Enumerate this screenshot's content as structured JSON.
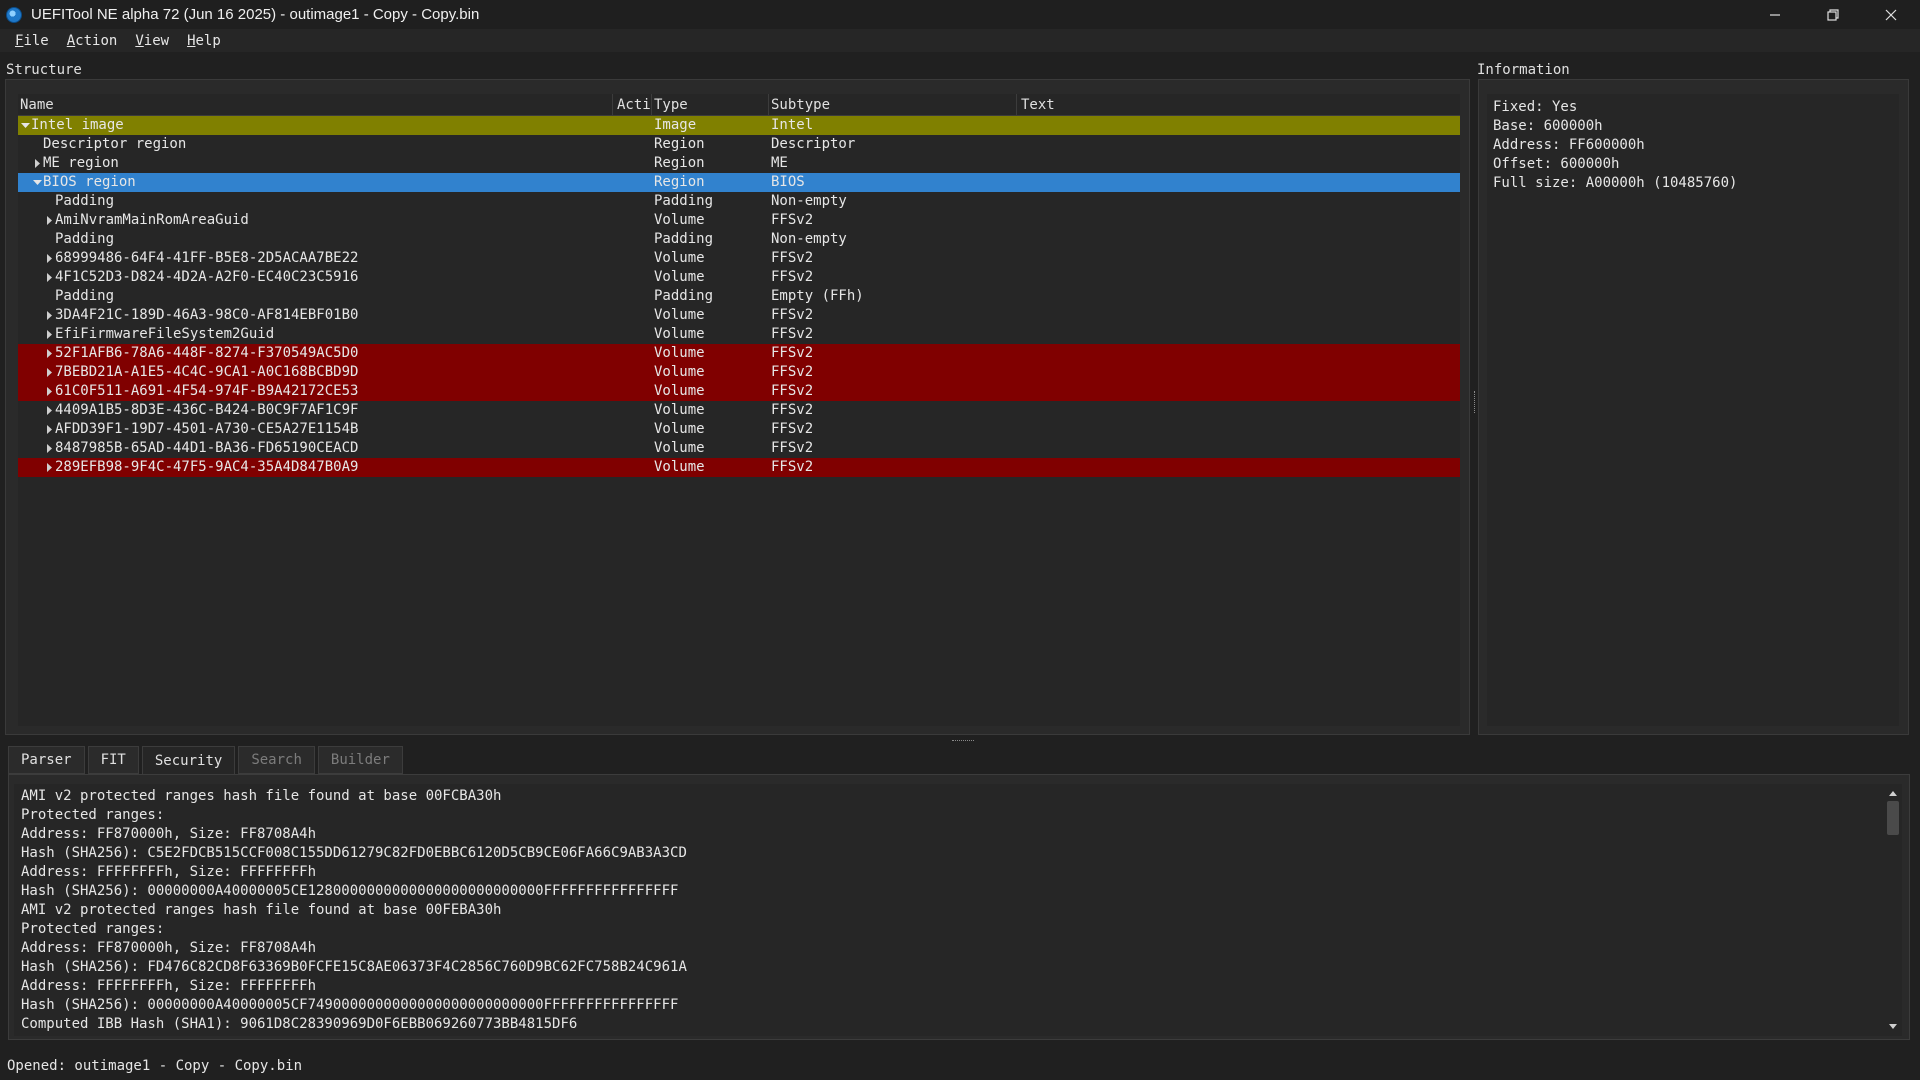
{
  "window": {
    "title": "UEFITool NE alpha 72 (Jun 16 2025) - outimage1 - Copy - Copy.bin",
    "app_icon": "uefitool-icon"
  },
  "menu": [
    {
      "label_ul": "F",
      "label_rest": "ile"
    },
    {
      "label_ul": "A",
      "label_rest": "ction"
    },
    {
      "label_ul": "V",
      "label_rest": "iew"
    },
    {
      "label_ul": "H",
      "label_rest": "elp"
    }
  ],
  "structure": {
    "title": "Structure",
    "columns": [
      "Name",
      "Acti",
      "Type",
      "Subtype",
      "Text"
    ],
    "rows": [
      {
        "name": "Intel image",
        "type": "Image",
        "subtype": "Intel",
        "indent": 0,
        "arrow": "down",
        "style": "intel"
      },
      {
        "name": "Descriptor region",
        "type": "Region",
        "subtype": "Descriptor",
        "indent": 1,
        "arrow": "none",
        "style": ""
      },
      {
        "name": "ME region",
        "type": "Region",
        "subtype": "ME",
        "indent": 1,
        "arrow": "right",
        "style": ""
      },
      {
        "name": "BIOS region",
        "type": "Region",
        "subtype": "BIOS",
        "indent": 1,
        "arrow": "down",
        "style": "selected"
      },
      {
        "name": "Padding",
        "type": "Padding",
        "subtype": "Non-empty",
        "indent": 2,
        "arrow": "none",
        "style": ""
      },
      {
        "name": "AmiNvramMainRomAreaGuid",
        "type": "Volume",
        "subtype": "FFSv2",
        "indent": 2,
        "arrow": "right",
        "style": ""
      },
      {
        "name": "Padding",
        "type": "Padding",
        "subtype": "Non-empty",
        "indent": 2,
        "arrow": "none",
        "style": ""
      },
      {
        "name": "68999486-64F4-41FF-B5E8-2D5ACAA7BE22",
        "type": "Volume",
        "subtype": "FFSv2",
        "indent": 2,
        "arrow": "right",
        "style": ""
      },
      {
        "name": "4F1C52D3-D824-4D2A-A2F0-EC40C23C5916",
        "type": "Volume",
        "subtype": "FFSv2",
        "indent": 2,
        "arrow": "right",
        "style": ""
      },
      {
        "name": "Padding",
        "type": "Padding",
        "subtype": "Empty (FFh)",
        "indent": 2,
        "arrow": "none",
        "style": ""
      },
      {
        "name": "3DA4F21C-189D-46A3-98C0-AF814EBF01B0",
        "type": "Volume",
        "subtype": "FFSv2",
        "indent": 2,
        "arrow": "right",
        "style": ""
      },
      {
        "name": "EfiFirmwareFileSystem2Guid",
        "type": "Volume",
        "subtype": "FFSv2",
        "indent": 2,
        "arrow": "right",
        "style": ""
      },
      {
        "name": "52F1AFB6-78A6-448F-8274-F370549AC5D0",
        "type": "Volume",
        "subtype": "FFSv2",
        "indent": 2,
        "arrow": "right",
        "style": "red"
      },
      {
        "name": "7BEBD21A-A1E5-4C4C-9CA1-A0C168BCBD9D",
        "type": "Volume",
        "subtype": "FFSv2",
        "indent": 2,
        "arrow": "right",
        "style": "red"
      },
      {
        "name": "61C0F511-A691-4F54-974F-B9A42172CE53",
        "type": "Volume",
        "subtype": "FFSv2",
        "indent": 2,
        "arrow": "right",
        "style": "red"
      },
      {
        "name": "4409A1B5-8D3E-436C-B424-B0C9F7AF1C9F",
        "type": "Volume",
        "subtype": "FFSv2",
        "indent": 2,
        "arrow": "right",
        "style": ""
      },
      {
        "name": "AFDD39F1-19D7-4501-A730-CE5A27E1154B",
        "type": "Volume",
        "subtype": "FFSv2",
        "indent": 2,
        "arrow": "right",
        "style": ""
      },
      {
        "name": "8487985B-65AD-44D1-BA36-FD65190CEACD",
        "type": "Volume",
        "subtype": "FFSv2",
        "indent": 2,
        "arrow": "right",
        "style": ""
      },
      {
        "name": "289EFB98-9F4C-47F5-9AC4-35A4D847B0A9",
        "type": "Volume",
        "subtype": "FFSv2",
        "indent": 2,
        "arrow": "right",
        "style": "red"
      }
    ]
  },
  "information": {
    "title": "Information",
    "lines": [
      "Fixed: Yes",
      "Base: 600000h",
      "Address: FF600000h",
      "Offset: 600000h",
      "Full size: A00000h (10485760)"
    ]
  },
  "tabs": [
    {
      "label": "Parser",
      "state": "normal"
    },
    {
      "label": "FIT",
      "state": "normal"
    },
    {
      "label": "Security",
      "state": "active"
    },
    {
      "label": "Search",
      "state": "disabled"
    },
    {
      "label": "Builder",
      "state": "disabled"
    }
  ],
  "log": {
    "lines": [
      "AMI v2 protected ranges hash file found at base 00FCBA30h",
      "Protected ranges:",
      "Address: FF870000h, Size: FF8708A4h",
      "Hash (SHA256): C5E2FDCB515CCF008C155DD61279C82FD0EBBC6120D5CB9CE06FA66C9AB3A3CD",
      "Address: FFFFFFFFh, Size: FFFFFFFFh",
      "Hash (SHA256): 00000000A40000005CE1280000000000000000000000000FFFFFFFFFFFFFFFF",
      "AMI v2 protected ranges hash file found at base 00FEBA30h",
      "Protected ranges:",
      "Address: FF870000h, Size: FF8708A4h",
      "Hash (SHA256): FD476C82CD8F63369B0FCFE15C8AE06373F4C2856C760D9BC62FC758B24C961A",
      "Address: FFFFFFFFh, Size: FFFFFFFFh",
      "Hash (SHA256): 00000000A40000005CF7490000000000000000000000000FFFFFFFFFFFFFFFF",
      "Computed IBB Hash (SHA1): 9061D8C28390969D0F6EBB069260773BB4815DF6"
    ]
  },
  "status": {
    "text": "Opened: outimage1 - Copy - Copy.bin"
  },
  "colors": {
    "intel_row": "#808000",
    "selected_row": "#3182ce",
    "invalid_row": "#800000",
    "background": "#202020"
  }
}
